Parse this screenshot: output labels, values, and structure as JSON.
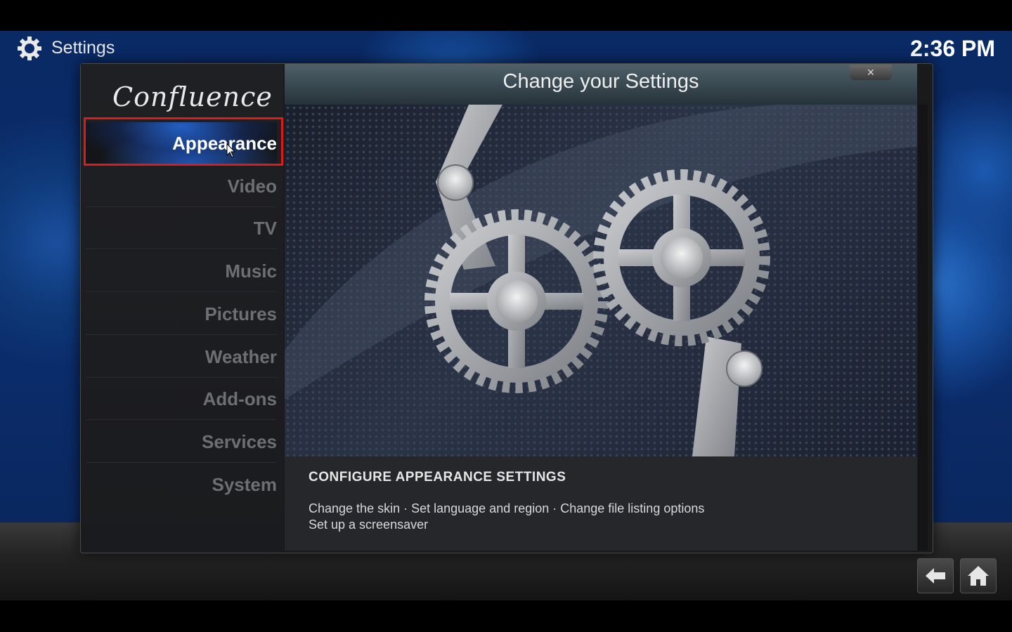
{
  "header": {
    "title": "Settings",
    "icon": "gear-icon",
    "clock": "2:36 PM"
  },
  "sidebar": {
    "logo_text": "Confluence",
    "items": [
      {
        "label": "Appearance",
        "active": true
      },
      {
        "label": "Video",
        "active": false
      },
      {
        "label": "TV",
        "active": false
      },
      {
        "label": "Music",
        "active": false
      },
      {
        "label": "Pictures",
        "active": false
      },
      {
        "label": "Weather",
        "active": false
      },
      {
        "label": "Add-ons",
        "active": false
      },
      {
        "label": "Services",
        "active": false
      },
      {
        "label": "System",
        "active": false
      }
    ]
  },
  "content": {
    "title": "Change your Settings",
    "close_label": "×",
    "artwork": "gears-artwork"
  },
  "info": {
    "heading": "CONFIGURE APPEARANCE SETTINGS",
    "line1": "Change the skin · Set language and region · Change file listing options",
    "line2": "Set up a screensaver"
  },
  "nav": {
    "back": "back-arrow-icon",
    "home": "home-icon"
  },
  "colors": {
    "highlight": "#e01a1a",
    "accent_glow": "#2878ff",
    "active_text": "#ffffff",
    "inactive_text": "#6d6f73"
  }
}
